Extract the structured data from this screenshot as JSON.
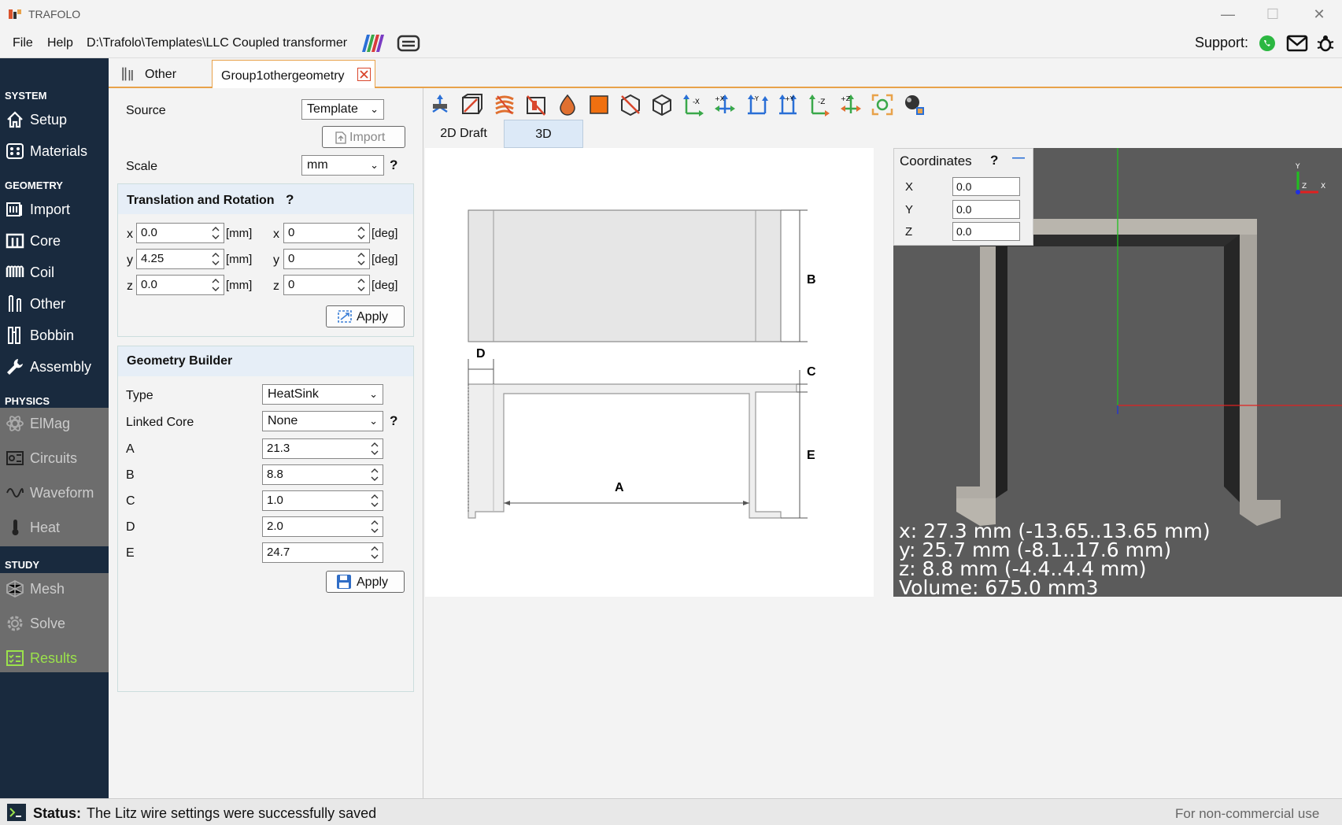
{
  "window": {
    "title": "TRAFOLO",
    "minimize": "—",
    "maximize": "☐",
    "close": "✕"
  },
  "menu": {
    "file": "File",
    "help": "Help",
    "path": "D:\\Trafolo\\Templates\\LLC Coupled transformer",
    "support_label": "Support:"
  },
  "sidebar": {
    "system_header": "SYSTEM",
    "geometry_header": "GEOMETRY",
    "physics_header": "PHYSICS",
    "study_header": "STUDY",
    "items": {
      "setup": "Setup",
      "materials": "Materials",
      "import": "Import",
      "core": "Core",
      "coil": "Coil",
      "other": "Other",
      "bobbin": "Bobbin",
      "assembly": "Assembly",
      "elmag": "ElMag",
      "circuits": "Circuits",
      "waveform": "Waveform",
      "heat": "Heat",
      "mesh": "Mesh",
      "solve": "Solve",
      "results": "Results"
    }
  },
  "tabs": {
    "other": "Other",
    "group": "Group1othergeometry"
  },
  "panel": {
    "source_label": "Source",
    "source_value": "Template",
    "import_button": "Import",
    "scale_label": "Scale",
    "scale_value": "mm",
    "help": "?",
    "translation": {
      "title": "Translation and Rotation",
      "x_label": "x",
      "y_label": "y",
      "z_label": "z",
      "tx": "0.0",
      "ty": "4.25",
      "tz": "0.0",
      "rx": "0",
      "ry": "0",
      "rz": "0",
      "mm_unit": "[mm]",
      "deg_unit": "[deg]",
      "apply": "Apply"
    },
    "builder": {
      "title": "Geometry Builder",
      "type_label": "Type",
      "type_value": "HeatSink",
      "linked_label": "Linked Core",
      "linked_value": "None",
      "a_label": "A",
      "a": "21.3",
      "b_label": "B",
      "b": "8.8",
      "c_label": "C",
      "c": "1.0",
      "d_label": "D",
      "d": "2.0",
      "e_label": "E",
      "e": "24.7",
      "apply": "Apply"
    }
  },
  "view_tabs": {
    "draft": "2D Draft",
    "three_d": "3D"
  },
  "draft_labels": {
    "a": "A",
    "b": "B",
    "c": "C",
    "d": "D",
    "e": "E"
  },
  "coordinates": {
    "title": "Coordinates",
    "help": "?",
    "collapse": "—",
    "x_label": "X",
    "y_label": "Y",
    "z_label": "Z",
    "x": "0.0",
    "y": "0.0",
    "z": "0.0"
  },
  "axis_labels": {
    "y": "Y",
    "z": "Z",
    "x": "X"
  },
  "dimensions": {
    "x": "x: 27.3 mm (-13.65..13.65 mm)",
    "y": "y: 25.7 mm (-8.1..17.6 mm)",
    "z": "z: 8.8 mm (-4.4..4.4 mm)",
    "volume": "Volume: 675.0 mm3"
  },
  "status": {
    "label": "Status:",
    "message": "The Litz wire settings were successfully saved",
    "license": "For non-commercial use"
  },
  "colors": {
    "sidebar": "#192a3e",
    "accent": "#e8a24a",
    "active_green": "#9be24b",
    "viewer_bg": "#5b5b5b"
  }
}
